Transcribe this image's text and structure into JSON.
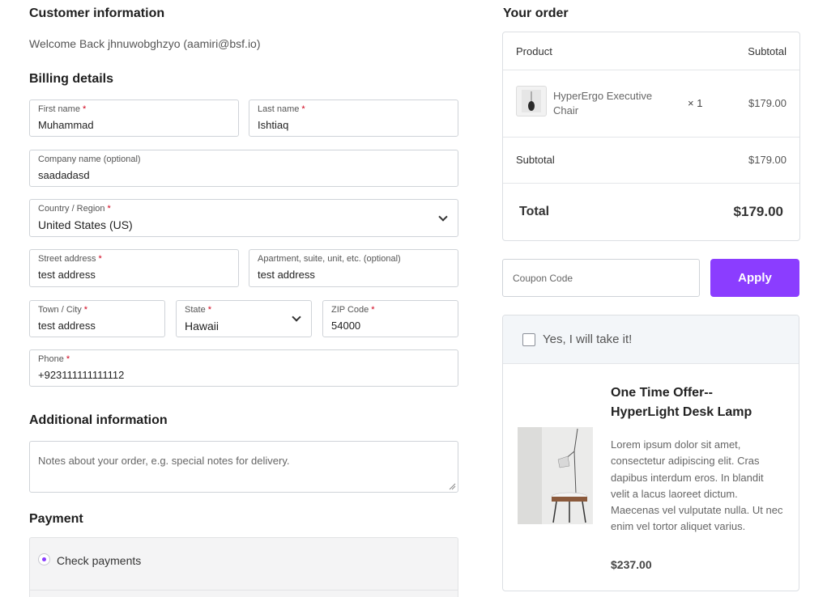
{
  "customer": {
    "heading": "Customer information",
    "welcome": "Welcome Back jhnuwobghzyo (aamiri@bsf.io)"
  },
  "billing": {
    "heading": "Billing details",
    "first_name": {
      "label": "First name",
      "value": "Muhammad"
    },
    "last_name": {
      "label": "Last name",
      "value": "Ishtiaq"
    },
    "company": {
      "label": "Company name (optional)",
      "value": "saadadasd"
    },
    "country": {
      "label": "Country / Region",
      "value": "United States (US)"
    },
    "street": {
      "label": "Street address",
      "value": "test address"
    },
    "apartment": {
      "label": "Apartment, suite, unit, etc. (optional)",
      "value": "test address"
    },
    "city": {
      "label": "Town / City",
      "value": "test address"
    },
    "state": {
      "label": "State",
      "value": "Hawaii"
    },
    "zip": {
      "label": "ZIP Code",
      "value": "54000"
    },
    "phone": {
      "label": "Phone",
      "value": "+923111111111112"
    },
    "required_mark": "*"
  },
  "additional": {
    "heading": "Additional information",
    "notes_placeholder": "Notes about your order, e.g. special notes for delivery."
  },
  "payment": {
    "heading": "Payment",
    "method": "Check payments"
  },
  "order": {
    "heading": "Your order",
    "col_product": "Product",
    "col_subtotal": "Subtotal",
    "item_name": "HyperErgo Executive Chair",
    "item_qty": "× 1",
    "item_price": "$179.00",
    "subtotal_label": "Subtotal",
    "subtotal_value": "$179.00",
    "total_label": "Total",
    "total_value": "$179.00"
  },
  "coupon": {
    "placeholder": "Coupon Code",
    "apply_label": "Apply"
  },
  "offer": {
    "checkbox_label": "Yes, I will take it!",
    "title": "One Time Offer-- HyperLight Desk Lamp",
    "description": "Lorem ipsum dolor sit amet, consectetur adipiscing elit. Cras dapibus interdum eros. In blandit velit a lacus laoreet dictum. Maecenas vel vulputate nulla. Ut nec enim vel tortor aliquet varius.",
    "price": "$237.00"
  },
  "colors": {
    "accent": "#8b3dff",
    "required": "#d0021b",
    "offer_header_bg": "#f3f6f9",
    "payment_bg": "#f4f4f5"
  }
}
